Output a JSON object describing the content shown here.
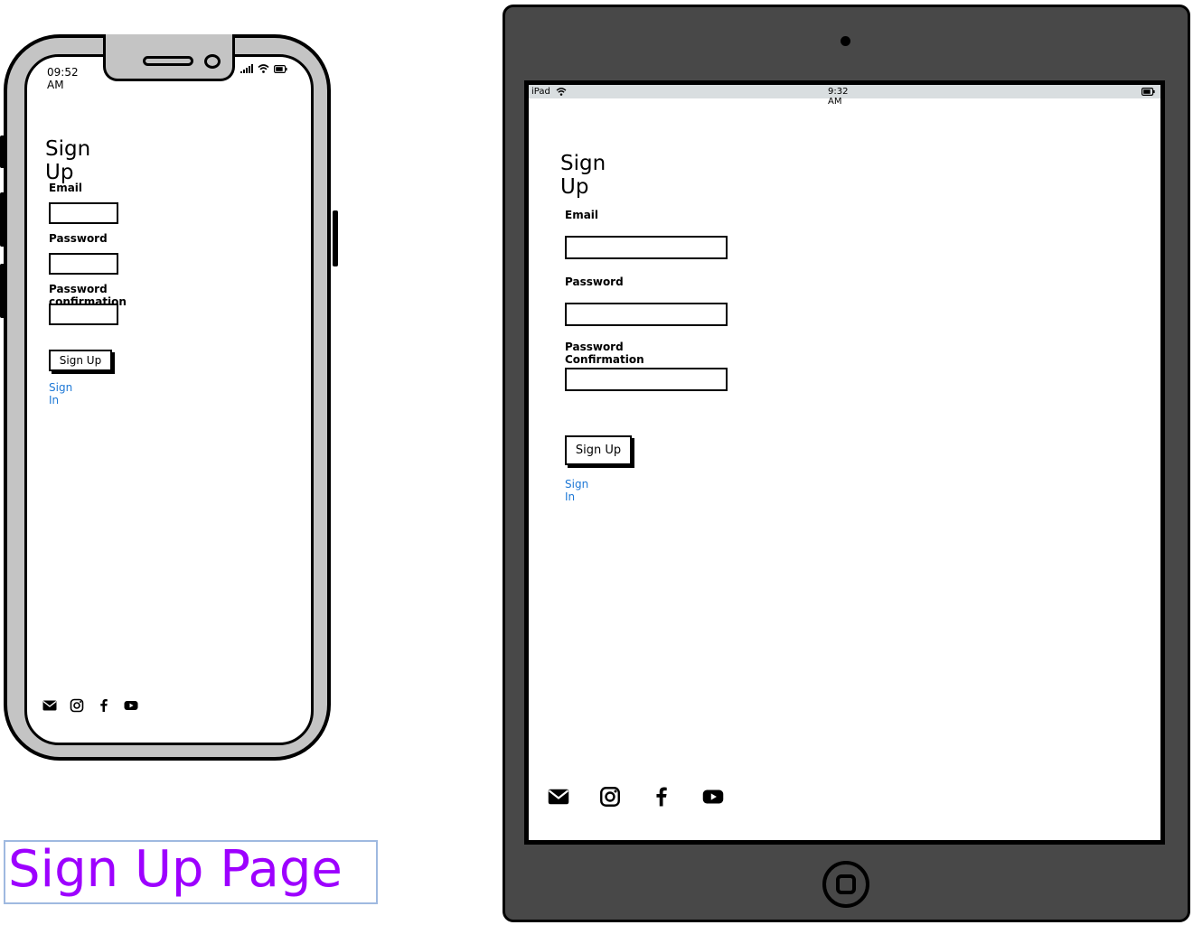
{
  "phone": {
    "status": {
      "time": "09:52 AM"
    },
    "title": "Sign Up",
    "fields": {
      "email_label": "Email",
      "password_label": "Password",
      "password_confirmation_label": "Password confirmation"
    },
    "submit_label": "Sign Up",
    "signin_link": "Sign In",
    "footer_icons": [
      "envelope-icon",
      "instagram-icon",
      "facebook-icon",
      "youtube-icon"
    ]
  },
  "tablet": {
    "status": {
      "device": "iPad",
      "time": "9:32 AM"
    },
    "title": "Sign Up",
    "fields": {
      "email_label": "Email",
      "password_label": "Password",
      "password_confirmation_label": "Password Confirmation"
    },
    "submit_label": "Sign Up",
    "signin_link": "Sign In",
    "footer_icons": [
      "envelope-icon",
      "instagram-icon",
      "facebook-icon",
      "youtube-icon"
    ]
  },
  "caption": "Sign Up Page",
  "colors": {
    "link": "#1e78d6",
    "caption": "#9d00ff",
    "caption_border": "#9fb9e0",
    "tablet_frame": "#484848",
    "phone_frame": "#c4c4c4",
    "tablet_statusbar": "#d9dee0"
  }
}
